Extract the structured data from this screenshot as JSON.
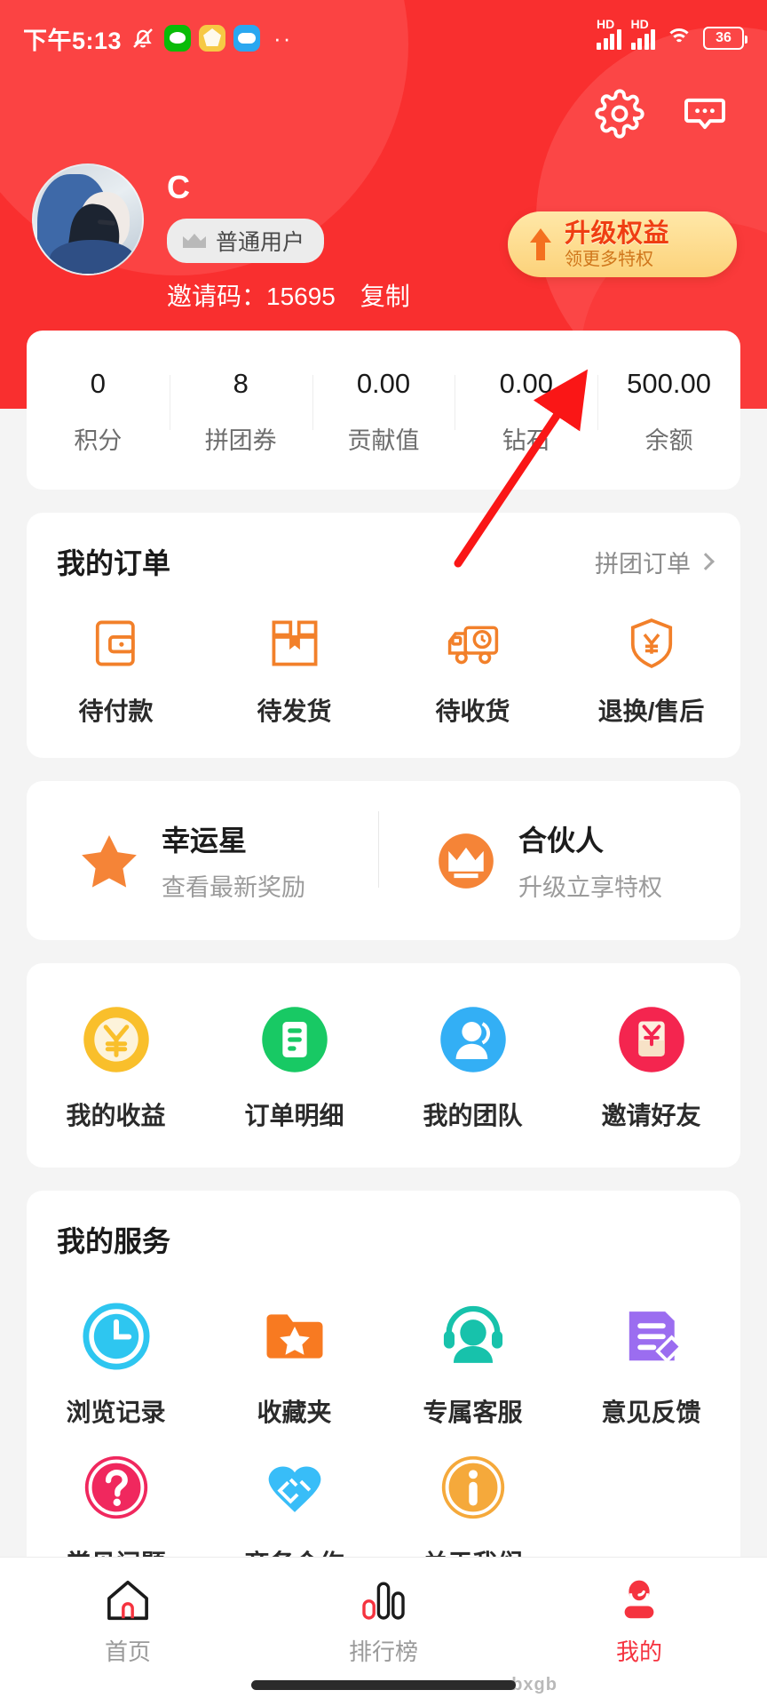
{
  "status_bar": {
    "time": "下午5:13",
    "battery": "36",
    "network_labels": [
      "HD",
      "HD"
    ],
    "icons": [
      "mute-bell-icon",
      "wechat-icon",
      "yellow-app-icon",
      "cloud-app-icon",
      "more-dots-icon",
      "signal-icon",
      "signal-icon",
      "wifi-icon",
      "battery-icon"
    ]
  },
  "header": {
    "settings_icon": "gear-icon",
    "message_icon": "chat-bubble-icon",
    "username": "C",
    "level_badge": "普通用户",
    "invite_label": "邀请码：15695",
    "copy_label": "复制",
    "upgrade": {
      "title": "升级权益",
      "subtitle": "领更多特权"
    },
    "bg_color": "#f92f2f"
  },
  "stats": [
    {
      "value": "0",
      "label": "积分"
    },
    {
      "value": "8",
      "label": "拼团券"
    },
    {
      "value": "0.00",
      "label": "贡献值"
    },
    {
      "value": "0.00",
      "label": "钻石"
    },
    {
      "value": "500.00",
      "label": "余额"
    }
  ],
  "orders": {
    "title": "我的订单",
    "link": "拼团订单",
    "items": [
      {
        "label": "待付款",
        "icon": "wallet-icon"
      },
      {
        "label": "待发货",
        "icon": "package-box-icon"
      },
      {
        "label": "待收货",
        "icon": "delivery-truck-icon"
      },
      {
        "label": "退换/售后",
        "icon": "shield-yuan-icon"
      }
    ]
  },
  "promos": [
    {
      "title": "幸运星",
      "subtitle": "查看最新奖励",
      "icon": "star-icon"
    },
    {
      "title": "合伙人",
      "subtitle": "升级立享特权",
      "icon": "crown-circle-icon"
    }
  ],
  "wallet_menu": [
    {
      "label": "我的收益",
      "icon": "yuan-coin-icon",
      "color": "#f9bf2b"
    },
    {
      "label": "订单明细",
      "icon": "order-list-icon",
      "color": "#18c964"
    },
    {
      "label": "我的团队",
      "icon": "team-person-icon",
      "color": "#33aff5"
    },
    {
      "label": "邀请好友",
      "icon": "red-envelope-icon",
      "color": "#f4254f"
    }
  ],
  "services": {
    "title": "我的服务",
    "items": [
      {
        "label": "浏览记录",
        "icon": "history-clock-icon",
        "color": "#2ec6f0"
      },
      {
        "label": "收藏夹",
        "icon": "favorites-folder-icon",
        "color": "#f87a21"
      },
      {
        "label": "专属客服",
        "icon": "headset-support-icon",
        "color": "#17c2ab"
      },
      {
        "label": "意见反馈",
        "icon": "feedback-note-icon",
        "color": "#9b6df0"
      },
      {
        "label": "常见问题",
        "icon": "question-mark-icon",
        "color": "#f0285e"
      },
      {
        "label": "商务合作",
        "icon": "handshake-icon",
        "color": "#38bdf8"
      },
      {
        "label": "关于我们",
        "icon": "info-circle-icon",
        "color": "#f5a93b"
      }
    ]
  },
  "tabbar": [
    {
      "label": "首页",
      "icon": "home-icon",
      "active": false
    },
    {
      "label": "排行榜",
      "icon": "ranking-bars-icon",
      "active": false
    },
    {
      "label": "我的",
      "icon": "profile-person-icon",
      "active": true
    }
  ],
  "watermark": "bxgb",
  "annotation": {
    "type": "arrow",
    "color": "#fa1616",
    "points_to": "余额"
  }
}
